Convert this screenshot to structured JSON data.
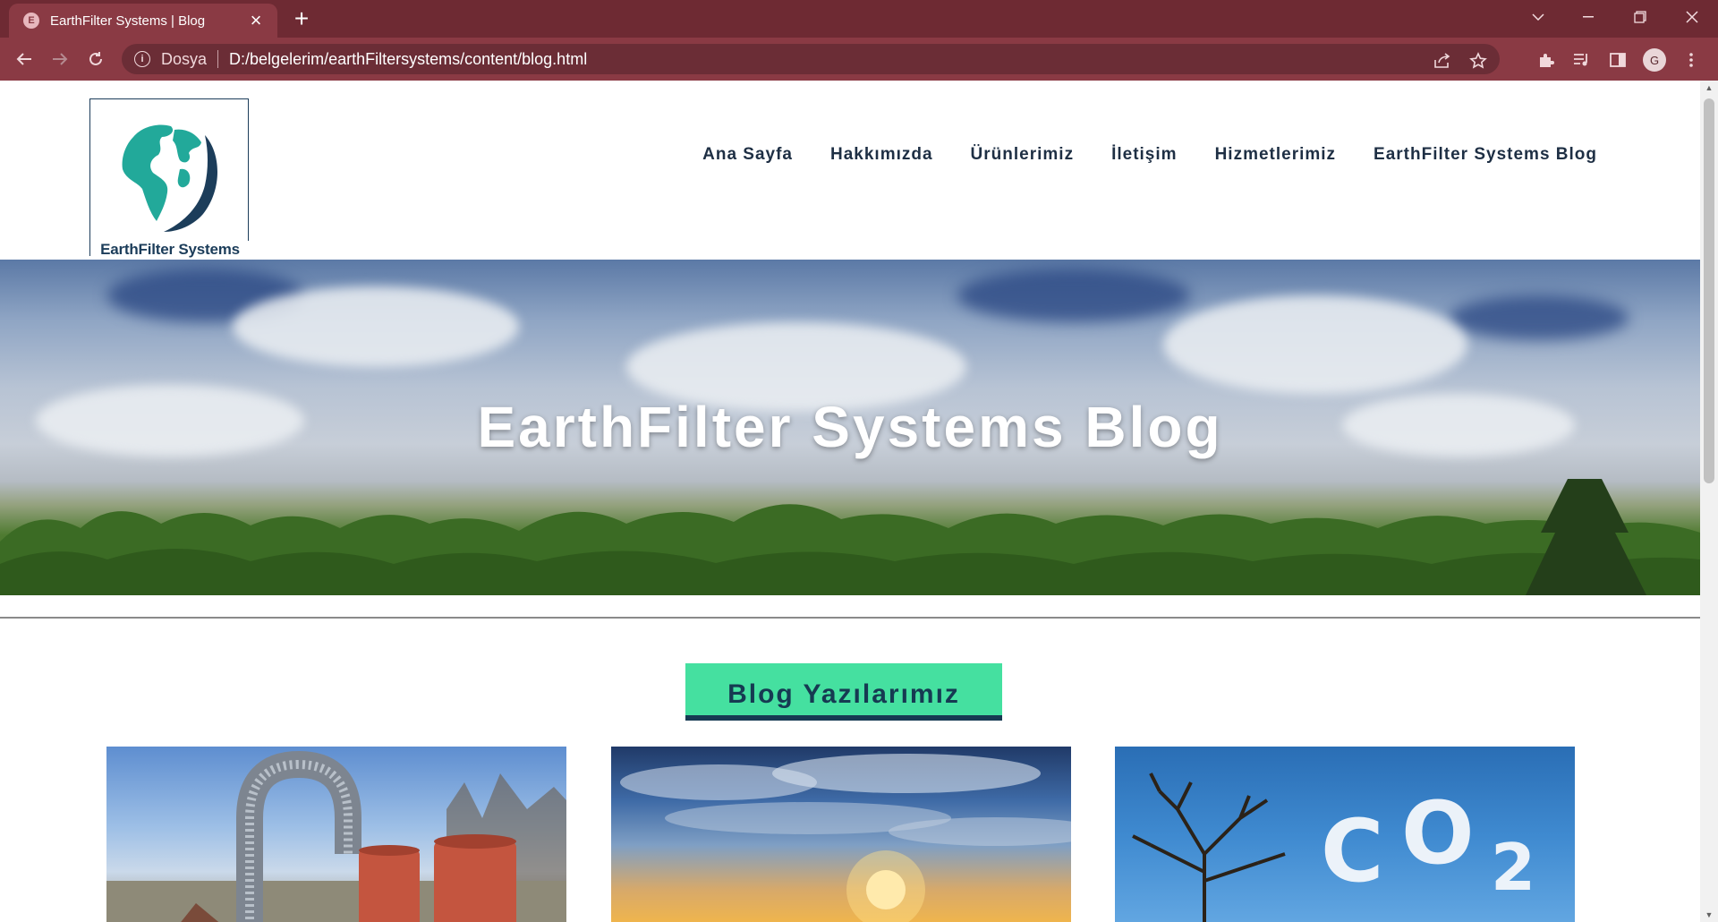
{
  "browser": {
    "tab_title": "EarthFilter Systems | Blog",
    "favicon_letter": "E",
    "scheme_label": "Dosya",
    "url": "D:/belgelerim/earthFiltersystems/content/blog.html",
    "profile_initial": "G",
    "accent_color": "#8a3a44"
  },
  "header": {
    "logo_text": "EarthFilter Systems",
    "nav": [
      {
        "label": "Ana Sayfa"
      },
      {
        "label": "Hakkımızda"
      },
      {
        "label": "Ürünlerimiz"
      },
      {
        "label": "İletişim"
      },
      {
        "label": "Hizmetlerimiz"
      },
      {
        "label": "EarthFilter Systems Blog"
      }
    ]
  },
  "hero": {
    "title": "EarthFilter Systems Blog"
  },
  "blog_section": {
    "title": "Blog Yazılarımız",
    "cards": [
      {
        "image": "chimney-pipe-photo"
      },
      {
        "image": "sunset-sky-photo"
      },
      {
        "image": "co2-cloud-photo",
        "caption_in_image": "CO2"
      }
    ]
  },
  "colors": {
    "section_title_bg": "#45e0a0",
    "section_title_text": "#163a52",
    "nav_text": "#1e2f44"
  }
}
